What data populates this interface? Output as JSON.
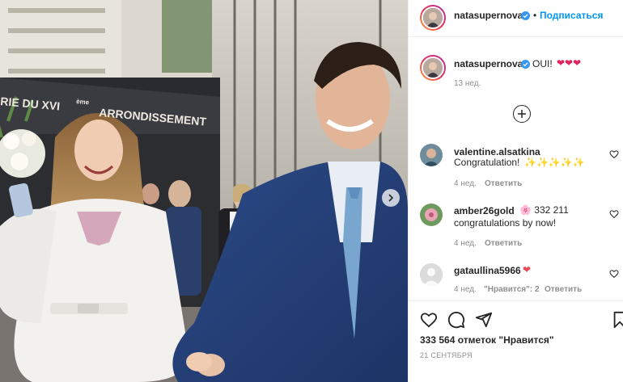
{
  "post": {
    "author": "natasupernova",
    "follow_label": "Подписаться",
    "separator": "•",
    "caption": {
      "username": "natasupernova",
      "text": "OUI!",
      "emoji": "❤❤❤",
      "time": "13 нед."
    },
    "photo": {
      "sign_line1": "RIE DU  XVI",
      "sign_sup": "ème",
      "sign_line2": "ARRONDISSEMENT"
    },
    "comments": [
      {
        "username": "valentine.alsatkina",
        "text": "Congratulation!",
        "emoji": "✨✨✨✨✨",
        "time": "4 нед.",
        "reply": "Ответить"
      },
      {
        "username": "amber26gold",
        "text_inline": "🌸 332 211",
        "text_line2": "congratulations by now!",
        "time": "4 нед.",
        "reply": "Ответить"
      },
      {
        "username": "gataullina5966",
        "emoji": "❤",
        "time": "4 нед.",
        "likes": "\"Нравится\": 2",
        "reply": "Ответить"
      }
    ],
    "likes_count": "333 564 отметок \"Нравится\"",
    "date": "21 СЕНТЯБРЯ"
  },
  "colors": {
    "accent": "#0095f6",
    "heart": "#ed4956",
    "muted": "#8e8e8e",
    "text": "#262626"
  },
  "icons": [
    "verified-icon",
    "plus-circle-icon",
    "heart-icon",
    "comment-icon",
    "share-icon",
    "bookmark-icon",
    "chevron-right-icon"
  ]
}
